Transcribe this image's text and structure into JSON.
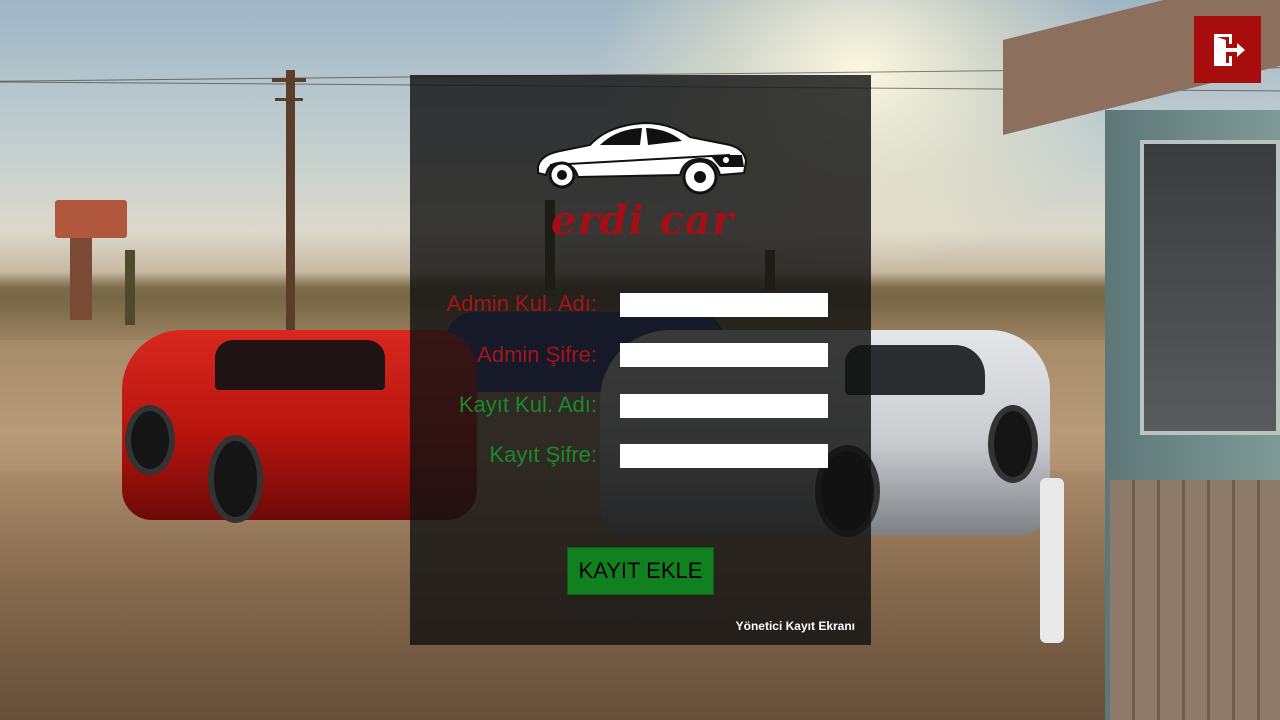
{
  "window": {
    "title": "Yönetici Kayıt Ekranı"
  },
  "logo": {
    "text": "erdi car",
    "icon": "sports-car-icon",
    "color": "#a20f14"
  },
  "form": {
    "admin_user_label": "Admin Kul. Adı:",
    "admin_user_value": "",
    "admin_password_label": "Admin Şifre:",
    "admin_password_value": "",
    "register_user_label": "Kayıt Kul. Adı:",
    "register_user_value": "",
    "register_password_label": "Kayıt Şifre:",
    "register_password_value": "",
    "submit_label": "KAYIT EKLE"
  },
  "footer": {
    "caption": "Yönetici Kayıt Ekranı"
  },
  "exit_button": {
    "icon": "exit-door-icon",
    "color": "#a70d0d"
  },
  "colors": {
    "admin_label": "#a6141a",
    "register_label": "#1c8a2a",
    "submit_button": "#11811f",
    "panel": "rgba(18,18,18,0.82)"
  },
  "background": {
    "icon": "desert-cars-photo"
  }
}
